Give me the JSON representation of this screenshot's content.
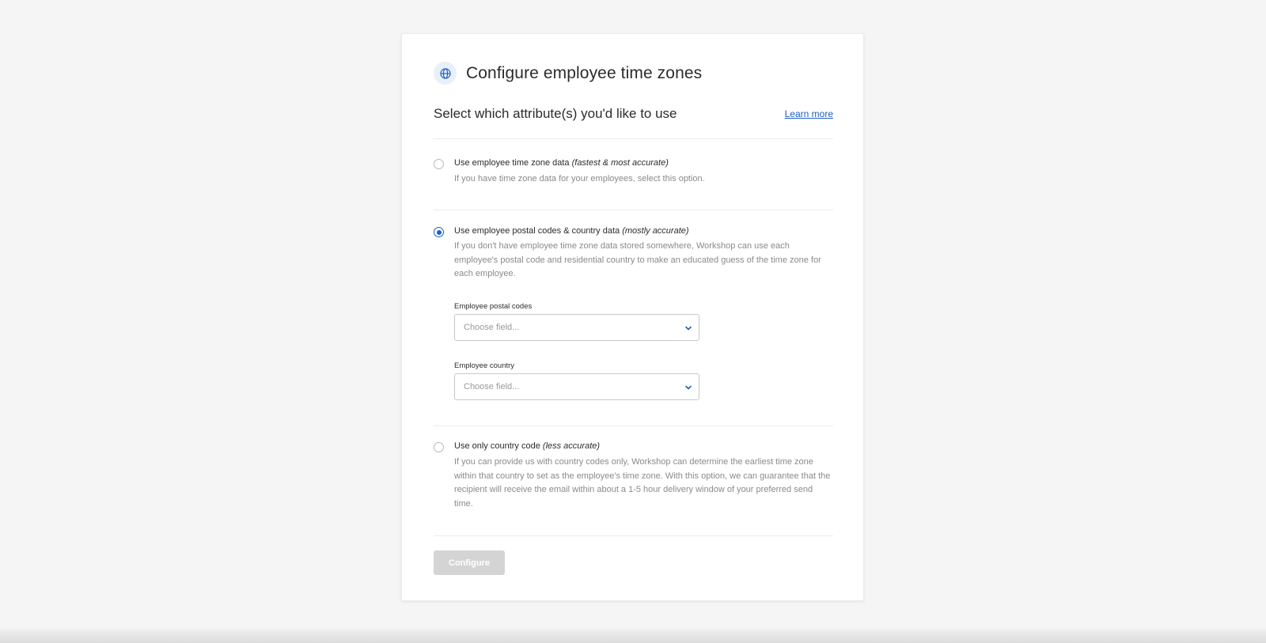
{
  "header": {
    "title": "Configure employee time zones",
    "icon": "globe-icon",
    "accent": "#1f5fc6"
  },
  "subheader": {
    "title": "Select which attribute(s) you'd like to use",
    "learn_more": "Learn more"
  },
  "options": [
    {
      "label": "Use employee time zone data",
      "qualifier": "(fastest & most accurate)",
      "description": "If you have time zone data for your employees, select this option.",
      "selected": false
    },
    {
      "label": "Use employee postal codes & country data",
      "qualifier": "(mostly accurate)",
      "description": "If you don't have employee time zone data stored somewhere, Workshop can use each employee's postal code and residential country to make an educated guess of the time zone for each employee.",
      "selected": true,
      "fields": [
        {
          "label": "Employee postal codes",
          "placeholder": "Choose field..."
        },
        {
          "label": "Employee country",
          "placeholder": "Choose field..."
        }
      ]
    },
    {
      "label": "Use only country code",
      "qualifier": "(less accurate)",
      "description": "If you can provide us with country codes only, Workshop can determine the earliest time zone within that country to set as the employee's time zone. With this option, we can guarantee that the recipient will receive the email within about a 1-5 hour delivery window of your preferred send time.",
      "selected": false
    }
  ],
  "actions": {
    "configure": "Configure",
    "configure_disabled": true
  }
}
